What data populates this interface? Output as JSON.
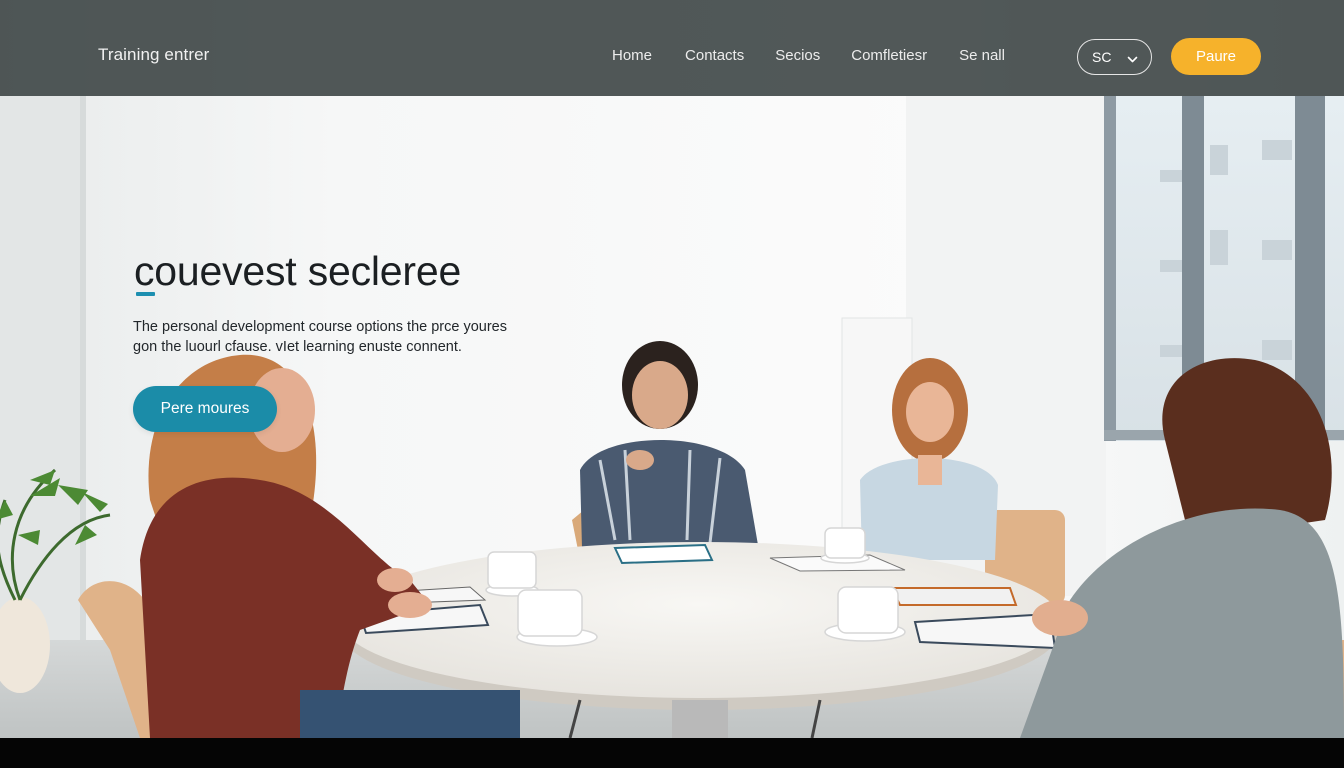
{
  "header": {
    "brand": "Training entrer",
    "nav": [
      {
        "label": "Home"
      },
      {
        "label": "Contacts"
      },
      {
        "label": "Secios"
      },
      {
        "label": "Comfletiesr"
      },
      {
        "label": "Se nall"
      }
    ],
    "language": {
      "selected": "SC"
    },
    "cta": "Paure"
  },
  "hero": {
    "title": "couevest seclerее",
    "description_lines": [
      "The personal development course options the prce youres",
      "gon the luourl cfause. vIet learning enuste connent."
    ],
    "cta": "Pere moures"
  },
  "colors": {
    "topbar": "#343c3c",
    "accent_yellow": "#f6b22b",
    "accent_teal": "#1b8ca8"
  },
  "icons": {
    "language_dropdown": "chevron-down-icon"
  }
}
